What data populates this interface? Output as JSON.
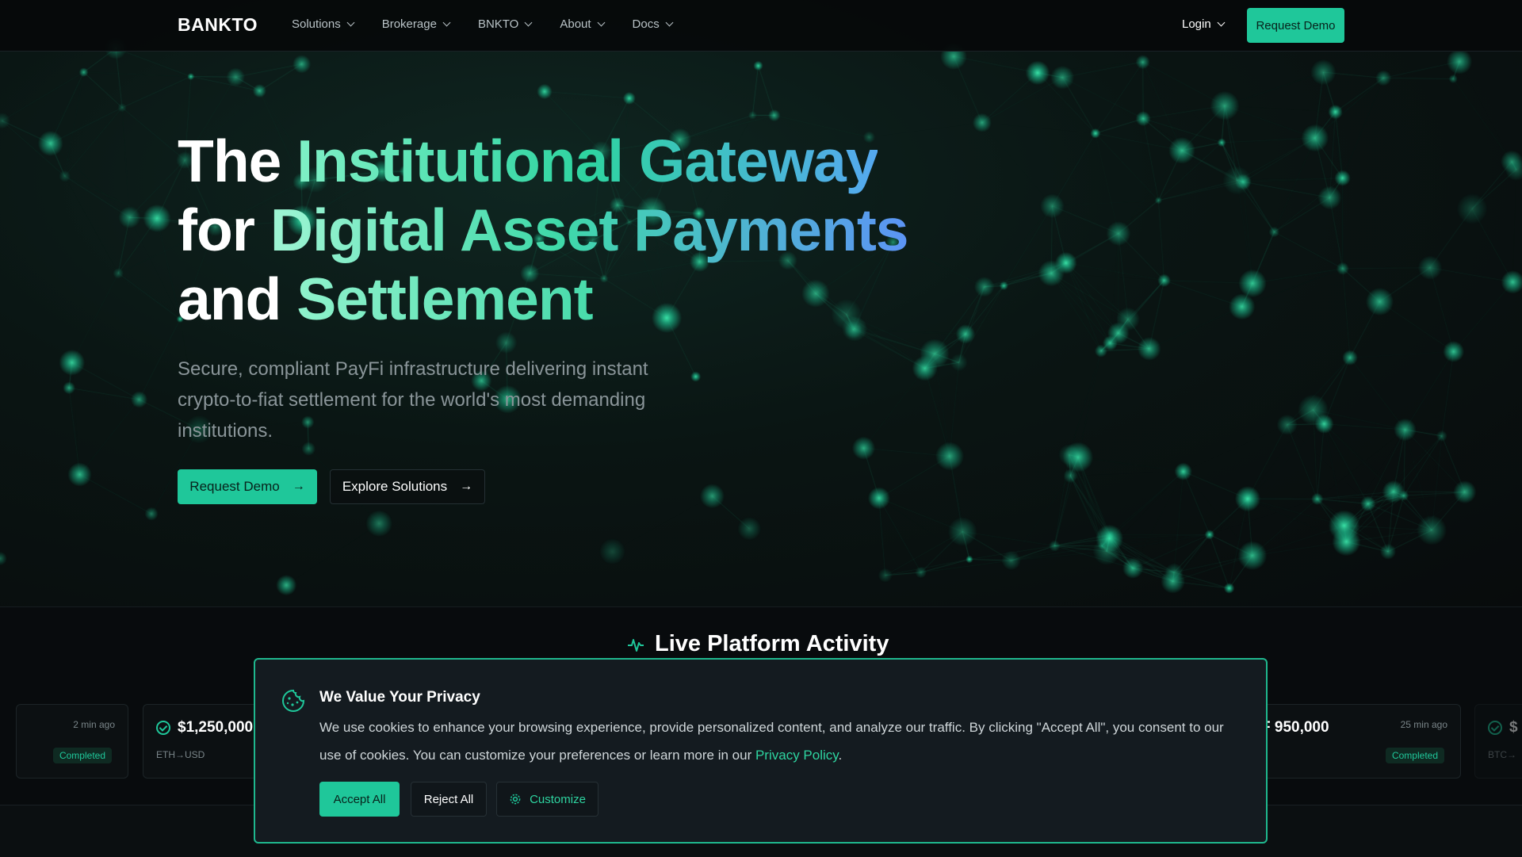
{
  "brand": "BANKTO",
  "nav": {
    "items": [
      {
        "label": "Solutions"
      },
      {
        "label": "Brokerage"
      },
      {
        "label": "BNKTO"
      },
      {
        "label": "About"
      },
      {
        "label": "Docs"
      }
    ],
    "login": "Login",
    "request_demo": "Request Demo"
  },
  "hero": {
    "line1_a": "The ",
    "line1_b": "Institutional Gateway",
    "line2_a": "for ",
    "line2_b": "Digital Asset Payments",
    "line3_a": "and ",
    "line3_b": "Settlement",
    "subtitle": "Secure, compliant PayFi infrastructure delivering instant crypto-to-fiat settlement for the world's most demanding institutions.",
    "primary_button": "Request Demo",
    "secondary_button": "Explore Solutions"
  },
  "activity": {
    "title": "Live Platform Activity",
    "cards": [
      {
        "amount": "",
        "pair": "",
        "time": "2 min ago",
        "status": "Completed"
      },
      {
        "amount": "$1,250,000",
        "pair": "ETH→USD",
        "time": "",
        "status": ""
      },
      {
        "amount": "F 950,000",
        "pair": "",
        "time": "25 min ago",
        "status": "Completed"
      },
      {
        "amount": "$",
        "pair": "BTC→",
        "time": "",
        "status": ""
      }
    ]
  },
  "cookie": {
    "title": "We Value Your Privacy",
    "text": "We use cookies to enhance your browsing experience, provide personalized content, and analyze our traffic. By clicking \"Accept All\", you consent to our use of cookies. You can customize your preferences or learn more in our ",
    "link": "Privacy Policy",
    "period": ".",
    "accept": "Accept All",
    "reject": "Reject All",
    "customize": "Customize"
  },
  "colors": {
    "accent": "#1fc79a",
    "background": "#0a0d0f",
    "gradient_start": "#7ff0c6",
    "gradient_end": "#55a8f0"
  },
  "icons": [
    "chevron-down-icon",
    "arrow-right-icon",
    "activity-pulse-icon",
    "check-circle-icon",
    "cookie-icon",
    "gear-icon"
  ]
}
